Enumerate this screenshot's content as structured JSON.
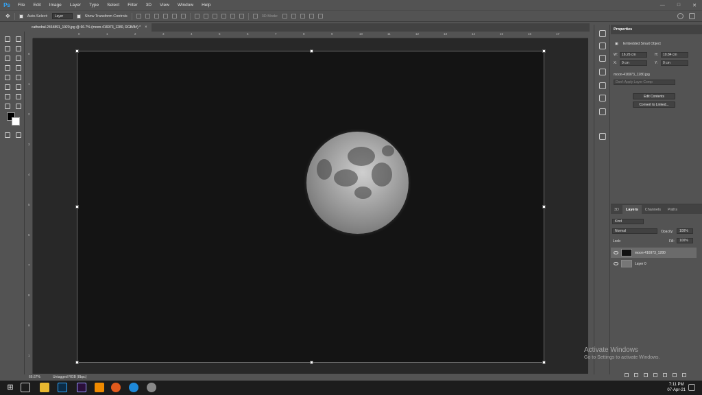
{
  "app": {
    "logo": "Ps"
  },
  "menu": [
    "File",
    "Edit",
    "Image",
    "Layer",
    "Type",
    "Select",
    "Filter",
    "3D",
    "View",
    "Window",
    "Help"
  ],
  "window_controls": {
    "minimize": "—",
    "maximize": "□",
    "close": "✕"
  },
  "options": {
    "auto_select_label": "Auto-Select:",
    "auto_select_target": "Layer",
    "show_transform_label": "Show Transform Controls",
    "mode_3d_label": "3D Mode:"
  },
  "document_tab": {
    "title": "cathedral-2464891_1920.jpg @ 66.7% (moon-416973_1280, RGB/8#) *",
    "close": "×"
  },
  "ruler_top_ticks": [
    "0",
    "1",
    "2",
    "3",
    "4",
    "5",
    "6",
    "7",
    "8",
    "9",
    "10",
    "11",
    "12",
    "13",
    "14",
    "15",
    "16",
    "17"
  ],
  "ruler_left_ticks": [
    "0",
    "1",
    "2",
    "3",
    "4",
    "5",
    "6",
    "7",
    "8",
    "9",
    "1"
  ],
  "status": {
    "zoom": "66.67%",
    "profile": "Untagged RGB (8bpc)"
  },
  "properties": {
    "header": "Properties",
    "object_type": "Embedded Smart Object",
    "w_label": "W:",
    "w_value": "16.26 cm",
    "h_label": "H:",
    "h_value": "10.84 cm",
    "x_label": "X:",
    "x_value": "0 cm",
    "y_label": "Y:",
    "y_value": "0 cm",
    "filename": "moon-416973_1280.jpg",
    "layer_comp": "Don't Apply Layer Comp",
    "edit_contents": "Edit Contents",
    "convert_linked": "Convert to Linked..."
  },
  "layers_panel": {
    "tabs": [
      "3D",
      "Layers",
      "Channels",
      "Paths"
    ],
    "kind_label": "Kind",
    "blend_mode": "Normal",
    "opacity_label": "Opacity:",
    "opacity_value": "100%",
    "lock_label": "Lock:",
    "fill_label": "Fill:",
    "fill_value": "100%",
    "layers": [
      {
        "name": "moon-416973_1280",
        "selected": true
      },
      {
        "name": "Layer 0",
        "selected": false
      }
    ]
  },
  "watermark": {
    "title": "Activate Windows",
    "subtitle": "Go to Settings to activate Windows."
  },
  "taskbar": {
    "apps": [
      "start",
      "search",
      "task-view",
      "file-explorer",
      "photoshop",
      "premiere",
      "vlc",
      "firefox",
      "edge",
      "blender"
    ],
    "time": "7:11 PM",
    "date": "07-Apr-21"
  },
  "colors": {
    "accent": "#31a8ff",
    "panel": "#535353",
    "canvas_bg": "#282828",
    "premiere": "#9999ff"
  }
}
